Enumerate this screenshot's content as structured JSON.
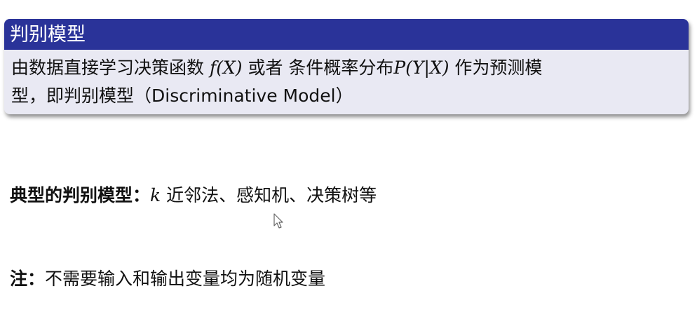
{
  "block": {
    "title": "判别模型",
    "line1_a": "由数据直接学习决策函数 ",
    "line1_math1": "f(X)",
    "line1_b": " 或者 条件概率分布",
    "line1_math2": "P(Y|X)",
    "line1_c": " 作为预测模",
    "line2": "型，即判别模型（Discriminative Model）"
  },
  "examples": {
    "label": "典型的判别模型：",
    "math_k": "k",
    "text": " 近邻法、感知机、决策树等"
  },
  "note": {
    "label": "注：",
    "text": "不需要输入和输出变量均为随机变量"
  },
  "icons": {
    "cursor": "mouse-pointer-icon"
  },
  "colors": {
    "header": "#2a3399",
    "block_body": "#e9e9f3"
  }
}
